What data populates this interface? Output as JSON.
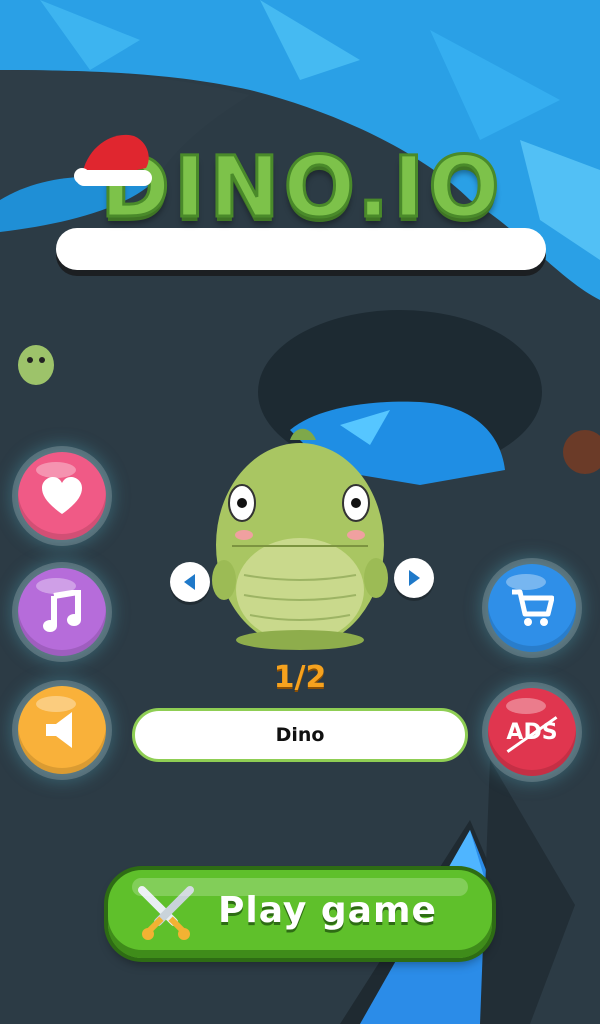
{
  "game": {
    "title": "DINO.IO",
    "skin_counter": "1/2",
    "skin_name": "Dino",
    "play_label": "Play game",
    "noads_label": "ADS"
  },
  "icons": {
    "like": "heart-icon",
    "music": "music-note-icon",
    "sound": "speaker-icon",
    "shop": "cart-icon",
    "noads": "no-ads-icon",
    "prev": "chevron-left-icon",
    "next": "chevron-right-icon",
    "play": "crossed-swords-icon"
  },
  "colors": {
    "like": "#f05a86",
    "music": "#b66cda",
    "sound": "#f9b13a",
    "shop": "#2f8fe8",
    "noads": "#e0364f",
    "play": "#5fc02b",
    "title": "#7dc24a",
    "counter": "#f6a21e"
  }
}
